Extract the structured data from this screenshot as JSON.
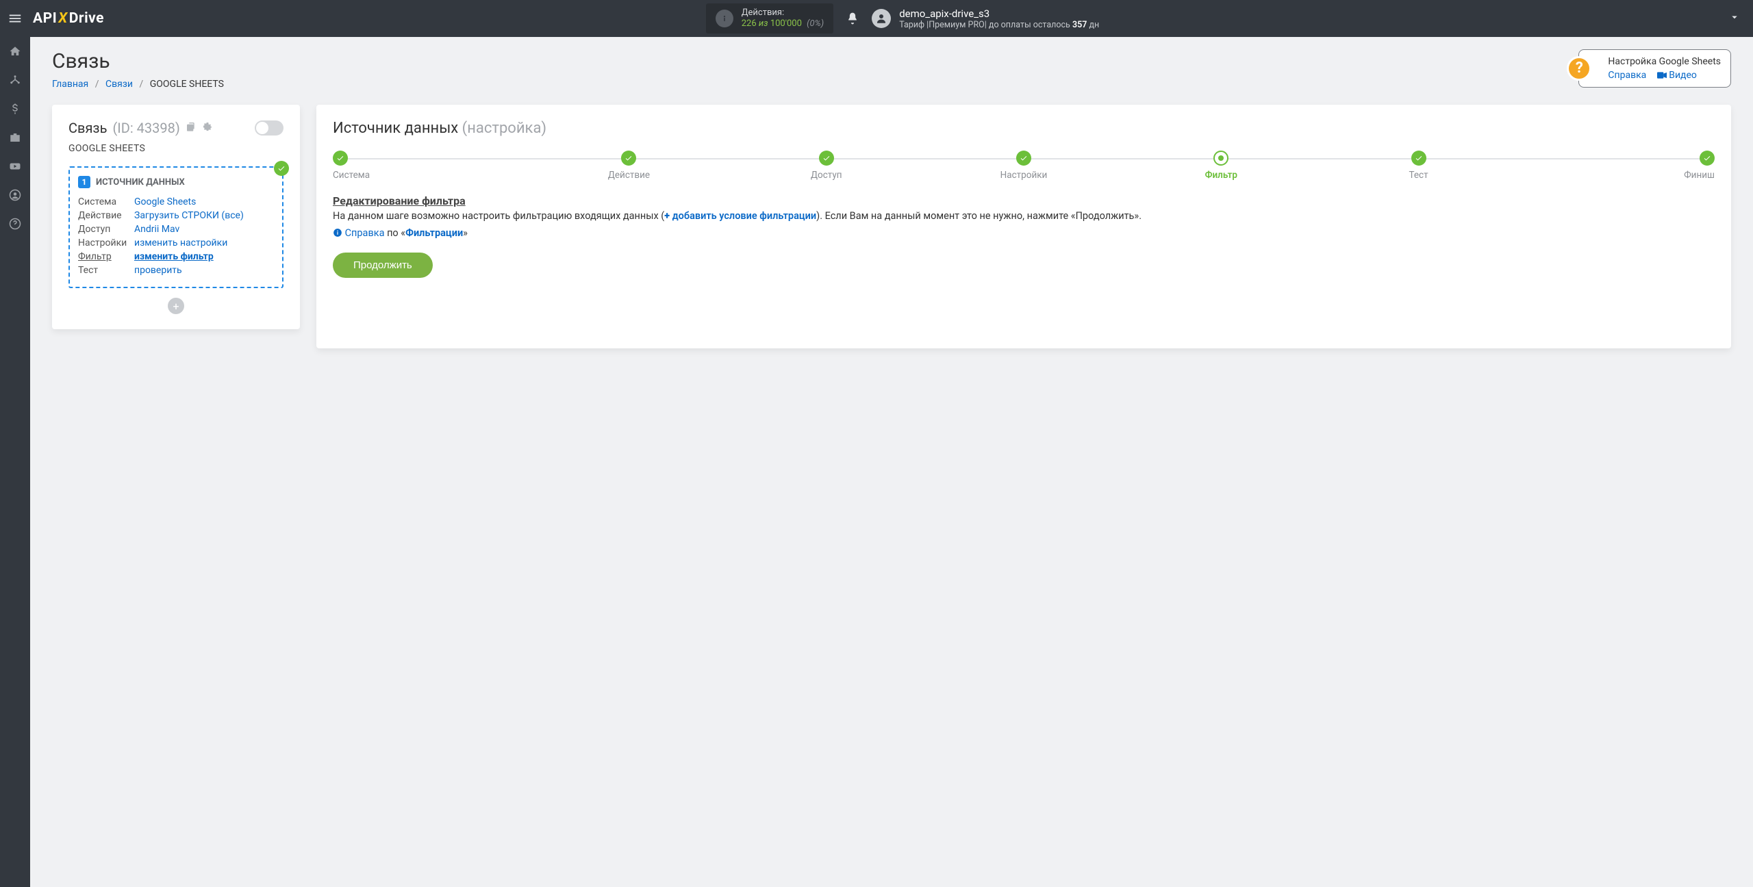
{
  "header": {
    "logo": {
      "api": "API",
      "x": "X",
      "drive": "Drive"
    },
    "actions": {
      "label": "Действия:",
      "used": "226",
      "of_word": "из",
      "max": "100'000",
      "pct": "(0%)"
    },
    "user": {
      "name": "demo_apix-drive_s3",
      "tariff_prefix": "Тариф |",
      "tariff_name": "Премиум PRO",
      "tariff_mid": "|  до оплаты осталось ",
      "tariff_days": "357",
      "tariff_suffix": " дн"
    }
  },
  "page": {
    "title": "Связь",
    "breadcrumbs": {
      "home": "Главная",
      "connections": "Связи",
      "current": "GOOGLE SHEETS"
    },
    "help": {
      "title": "Настройка Google Sheets",
      "reference": "Справка",
      "video": "Видео"
    }
  },
  "left": {
    "heading": "Связь",
    "id_label": "(ID: 43398)",
    "system": "GOOGLE SHEETS",
    "box_title": "ИСТОЧНИК ДАННЫХ",
    "box_badge": "1",
    "rows": {
      "system": {
        "k": "Система",
        "v": "Google Sheets"
      },
      "action": {
        "k": "Действие",
        "v": "Загрузить СТРОКИ (все)"
      },
      "access": {
        "k": "Доступ",
        "v": "Andrii Mav"
      },
      "settings": {
        "k": "Настройки",
        "v": "изменить настройки"
      },
      "filter": {
        "k": "Фильтр",
        "v": "изменить фильтр"
      },
      "test": {
        "k": "Тест",
        "v": "проверить"
      }
    }
  },
  "right": {
    "title": "Источник данных",
    "subtitle": "(настройка)",
    "steps": {
      "system": "Система",
      "action": "Действие",
      "access": "Доступ",
      "settings": "Настройки",
      "filter": "Фильтр",
      "test": "Тест",
      "finish": "Финиш"
    },
    "filter_heading": "Редактирование фильтра",
    "desc_pre": "На данном шаге возможно настроить фильтрацию входящих данных (",
    "desc_link": "добавить условие фильтрации",
    "desc_post": "). Если Вам на данный момент это не нужно, нажмите «Продолжить».",
    "hint_ref": "Справка",
    "hint_mid": " по «",
    "hint_topic": "Фильтрации",
    "hint_end": "»",
    "continue": "Продолжить"
  }
}
